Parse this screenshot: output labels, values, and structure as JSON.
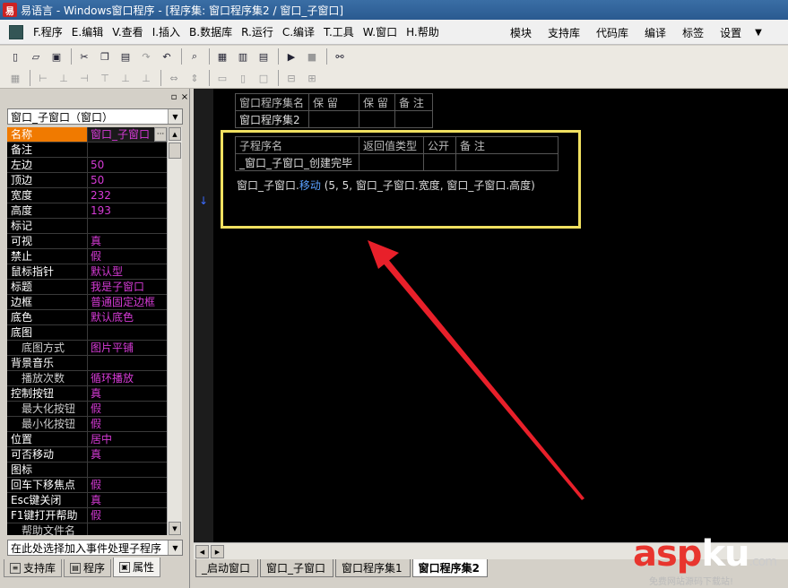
{
  "window": {
    "title": "易语言 - Windows窗口程序 - [程序集: 窗口程序集2 / 窗口_子窗口]",
    "app_icon_text": "易"
  },
  "menubar": {
    "items": [
      "F.程序",
      "E.编辑",
      "V.查看",
      "I.插入",
      "B.数据库",
      "R.运行",
      "C.编译",
      "T.工具",
      "W.窗口",
      "H.帮助"
    ],
    "right_items": [
      "模块",
      "支持库",
      "代码库",
      "编译",
      "标签",
      "设置"
    ],
    "dropdown_glyph": "▼"
  },
  "left_panel": {
    "pin_glyph": "▫",
    "close_glyph": "×",
    "object_combo": "窗口_子窗口（窗口）",
    "event_combo": "在此处选择加入事件处理子程序",
    "properties": [
      {
        "name": "名称",
        "value": "窗口_子窗口",
        "selected": true
      },
      {
        "name": "备注",
        "value": ""
      },
      {
        "name": "左边",
        "value": "50"
      },
      {
        "name": "顶边",
        "value": "50"
      },
      {
        "name": "宽度",
        "value": "232"
      },
      {
        "name": "高度",
        "value": "193"
      },
      {
        "name": "标记",
        "value": ""
      },
      {
        "name": "可视",
        "value": "真"
      },
      {
        "name": "禁止",
        "value": "假"
      },
      {
        "name": "鼠标指针",
        "value": "默认型"
      },
      {
        "name": "标题",
        "value": "我是子窗口"
      },
      {
        "name": "边框",
        "value": "普通固定边框"
      },
      {
        "name": "底色",
        "value": "默认底色"
      },
      {
        "name": "底图",
        "value": ""
      },
      {
        "name": "底图方式",
        "value": "图片平铺",
        "sub": true
      },
      {
        "name": "背景音乐",
        "value": ""
      },
      {
        "name": "播放次数",
        "value": "循环播放",
        "sub": true
      },
      {
        "name": "控制按钮",
        "value": "真"
      },
      {
        "name": "最大化按钮",
        "value": "假",
        "sub": true
      },
      {
        "name": "最小化按钮",
        "value": "假",
        "sub": true
      },
      {
        "name": "位置",
        "value": "居中"
      },
      {
        "name": "可否移动",
        "value": "真"
      },
      {
        "name": "图标",
        "value": ""
      },
      {
        "name": "回车下移焦点",
        "value": "假"
      },
      {
        "name": "Esc键关闭",
        "value": "真"
      },
      {
        "name": "F1键打开帮助",
        "value": "假"
      },
      {
        "name": "帮助文件名",
        "value": "",
        "sub": true
      }
    ],
    "tabs": [
      "支持库",
      "程序",
      "属性"
    ]
  },
  "editor": {
    "assembly_table": {
      "headers": [
        "窗口程序集名",
        "保 留",
        "保 留",
        "备 注"
      ],
      "row": [
        "窗口程序集2",
        "",
        "",
        ""
      ]
    },
    "sub_table": {
      "headers": [
        "子程序名",
        "返回值类型",
        "公开",
        "备 注"
      ],
      "row": [
        "_窗口_子窗口_创建完毕",
        "",
        "",
        ""
      ]
    },
    "code": {
      "object": "窗口_子窗口",
      "method": "移动",
      "args": "(5, 5, 窗口_子窗口.宽度, 窗口_子窗口.高度)"
    },
    "gutter_marker": "↓"
  },
  "doc_tabs": [
    "_启动窗口",
    "窗口_子窗口",
    "窗口程序集1",
    "窗口程序集2"
  ],
  "watermark": {
    "brand_a": "asp",
    "brand_b": "ku",
    "suffix": ".com",
    "subtitle": "免费网站源码下载站!"
  },
  "colors": {
    "editor_bg": "#000000",
    "highlight": "#f0e060",
    "arrow": "#e8202a",
    "property_value": "#d63bd6",
    "selected_property": "#f07a00"
  }
}
